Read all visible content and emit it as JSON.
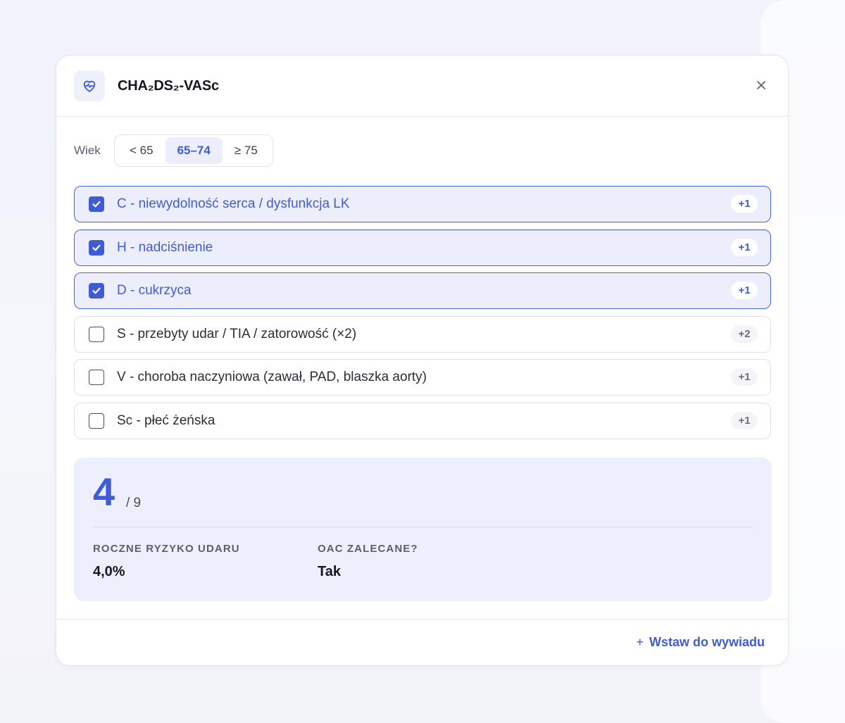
{
  "header": {
    "title": "CHA₂DS₂-VASc",
    "icon": "heart-pulse-icon",
    "close_icon": "close-icon"
  },
  "age": {
    "label": "Wiek",
    "options": [
      "< 65",
      "65–74",
      "≥ 75"
    ],
    "selected": "65–74"
  },
  "criteria": [
    {
      "label": "C - niewydolność serca / dysfunkcja LK",
      "points": "+1",
      "checked": true
    },
    {
      "label": "H - nadciśnienie",
      "points": "+1",
      "checked": true
    },
    {
      "label": "D - cukrzyca",
      "points": "+1",
      "checked": true
    },
    {
      "label": "S - przebyty udar / TIA / zatorowość (×2)",
      "points": "+2",
      "checked": false
    },
    {
      "label": "V - choroba naczyniowa (zawał, PAD, blaszka aorty)",
      "points": "+1",
      "checked": false
    },
    {
      "label": "Sc - płeć żeńska",
      "points": "+1",
      "checked": false
    }
  ],
  "result": {
    "score": "4",
    "max": "/ 9",
    "metrics": [
      {
        "label": "ROCZNE RYZYKO UDARU",
        "value": "4,0%"
      },
      {
        "label": "OAC ZALECANE?",
        "value": "Tak"
      }
    ]
  },
  "footer": {
    "insert_icon": "+",
    "insert_label": "Wstaw do wywiadu"
  },
  "colors": {
    "accent": "#3f5bd6",
    "accent_bg": "#eceffb"
  }
}
